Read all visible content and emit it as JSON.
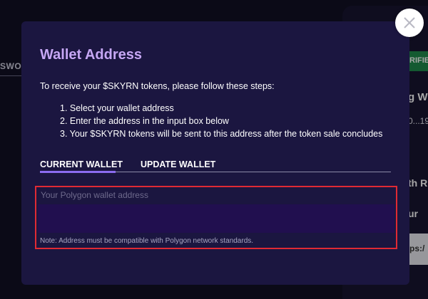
{
  "background": {
    "left_label": "SWOF",
    "right_top": "u",
    "badge": "RIFIE",
    "heading": "g W",
    "number": "0...19",
    "heading2": "th R",
    "heading3": "ur",
    "input_text": "ps:/"
  },
  "modal": {
    "title": "Wallet Address",
    "intro": "To receive your $SKYRN tokens, please follow these steps:",
    "steps": [
      "1. Select your wallet address",
      "2. Enter the address in the input box below",
      "3. Your $SKYRN tokens will be sent to this address after the token sale concludes"
    ],
    "tabs": {
      "current": "CURRENT WALLET",
      "update": "UPDATE WALLET"
    },
    "address": {
      "placeholder": "Your Polygon wallet address",
      "value": "",
      "note": "Note: Address must be compatible with Polygon network standards."
    }
  },
  "colors": {
    "title": "#c6a7f4",
    "modal_bg": "#1b1640",
    "tab_underline": "#8b6cf0",
    "highlight_border": "#e02a34",
    "input_bg": "#210f4f"
  },
  "icons": {
    "close": "close-icon"
  }
}
